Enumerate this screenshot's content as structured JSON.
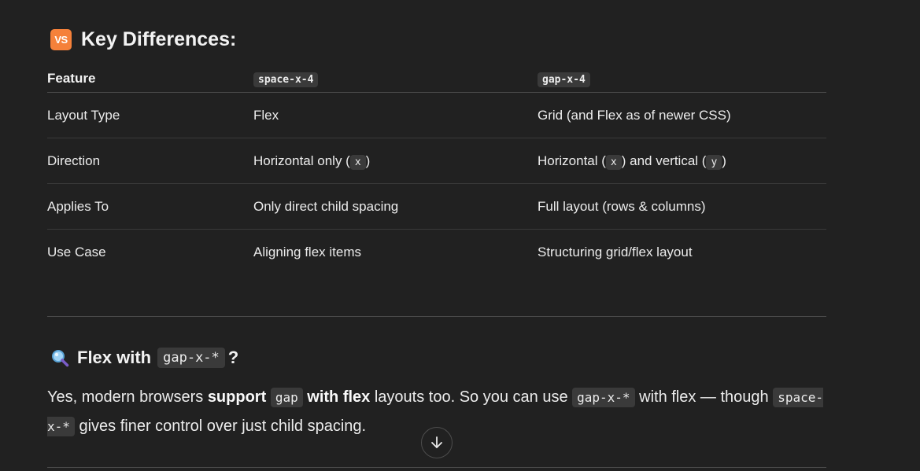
{
  "section1": {
    "icon": "vs-icon",
    "icon_text": "VS",
    "title": "Key Differences:"
  },
  "table": {
    "headers": [
      "Feature",
      "space-x-4",
      "gap-x-4"
    ],
    "rows": [
      {
        "feature": "Layout Type",
        "space": "Flex",
        "gap": "Grid (and Flex as of newer CSS)"
      },
      {
        "feature": "Direction",
        "space_pre": "Horizontal only (",
        "space_code": "x",
        "space_post": ")",
        "gap_pre": "Horizontal (",
        "gap_code1": "x",
        "gap_mid": ") and vertical (",
        "gap_code2": "y",
        "gap_post": ")"
      },
      {
        "feature": "Applies To",
        "space": "Only direct child spacing",
        "gap": "Full layout (rows & columns)"
      },
      {
        "feature": "Use Case",
        "space": "Aligning flex items",
        "gap": "Structuring grid/flex layout"
      }
    ]
  },
  "section2": {
    "icon": "magnifier-icon",
    "title_pre": "Flex with",
    "title_code": "gap-x-*",
    "title_post": "?"
  },
  "paragraph": {
    "t1": "Yes, modern browsers ",
    "b1": "support",
    "c1": "gap",
    "b2": "with flex",
    "t2": " layouts too. So you can use ",
    "c2": "gap-x-*",
    "t3": " with flex — though ",
    "c3": "space-x-*",
    "t4": " gives finer control over just child spacing."
  },
  "scroll_button": {
    "icon": "arrow-down-icon"
  }
}
